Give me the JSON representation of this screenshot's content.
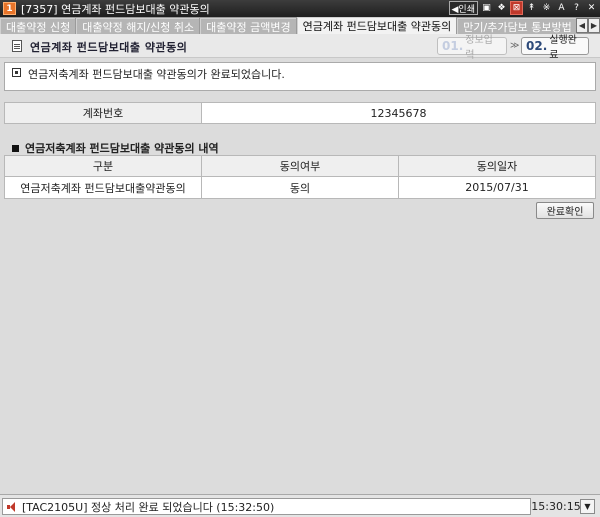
{
  "window": {
    "badge": "1",
    "title": "[7357] 연금계좌 펀드담보대출 약관동의",
    "tools": [
      "◀인쇄",
      "▣",
      "❖",
      "⊠",
      "↟",
      "※",
      "A",
      "?",
      "✕"
    ]
  },
  "tabs": [
    {
      "label": "대출약정 신청",
      "active": false
    },
    {
      "label": "대출약정 해지/신청 취소",
      "active": false
    },
    {
      "label": "대출약정 금액변경",
      "active": false
    },
    {
      "label": "연금계좌 펀드담보대출 약관동의",
      "active": true
    },
    {
      "label": "만기/추가담보 통보방법",
      "active": false
    }
  ],
  "tab_arrows": {
    "left": "◀",
    "right": "▶"
  },
  "header": {
    "title": "연금계좌 펀드담보대출 약관동의",
    "step1_num": "01.",
    "step1_label": "정보입력",
    "step_sep": "≫",
    "step2_num": "02.",
    "step2_label": "실행완료"
  },
  "message": "연금저축계좌 펀드담보대출 약관동의가 완료되었습니다.",
  "account": {
    "label": "계좌번호",
    "value": "12345678"
  },
  "section_title": "연금저축계좌 펀드담보대출 약관동의 내역",
  "table": {
    "headers": [
      "구분",
      "동의여부",
      "동의일자"
    ],
    "rows": [
      [
        "연금저축계좌 펀드담보대출약관동의",
        "동의",
        "2015/07/31"
      ]
    ]
  },
  "confirm_label": "완료확인",
  "status": {
    "message": "[TAC2105U] 정상 처리 완료 되었습니다 (15:32:50)",
    "time": "15:30:15",
    "dropdown": "▼"
  },
  "colors": {
    "accent": "#2d4a7a",
    "badge": "#e8742a",
    "close": "#c0392b"
  }
}
